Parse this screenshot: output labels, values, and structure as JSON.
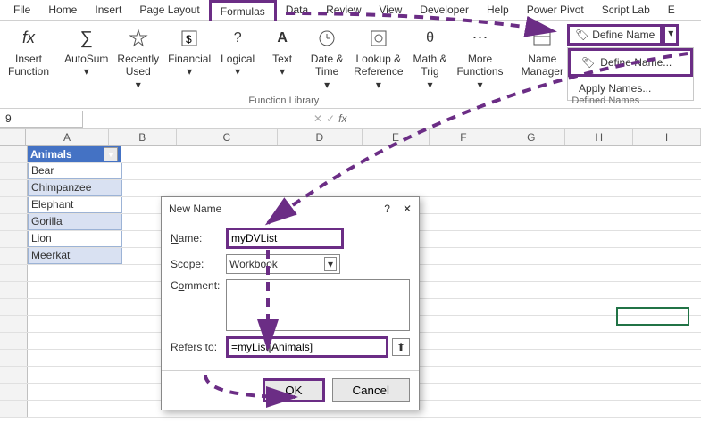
{
  "tabs": {
    "file": "File",
    "home": "Home",
    "insert": "Insert",
    "page_layout": "Page Layout",
    "formulas": "Formulas",
    "data": "Data",
    "review": "Review",
    "view": "View",
    "developer": "Developer",
    "help": "Help",
    "power_pivot": "Power Pivot",
    "script_lab": "Script Lab",
    "extra": "E"
  },
  "ribbon": {
    "insert_function": "Insert\nFunction",
    "autosum": "AutoSum",
    "recently_used": "Recently\nUsed",
    "financial": "Financial",
    "logical": "Logical",
    "text": "Text",
    "date_time": "Date &\nTime",
    "lookup_ref": "Lookup &\nReference",
    "math_trig": "Math &\nTrig",
    "more_functions": "More\nFunctions",
    "name_manager": "Name\nManager",
    "define_name": "Define Name",
    "define_name_menu": "Define Name...",
    "apply_names": "Apply Names...",
    "group_function_library": "Function Library",
    "group_defined_names": "Defined Names"
  },
  "name_box": "9",
  "fx_bar": {
    "check": "✓",
    "x": "✕",
    "fx": "fx"
  },
  "columns": [
    "A",
    "B",
    "C",
    "D",
    "E",
    "F",
    "G",
    "H",
    "I"
  ],
  "table": {
    "header": "Animals",
    "rows": [
      "Bear",
      "Chimpanzee",
      "Elephant",
      "Gorilla",
      "Lion",
      "Meerkat"
    ]
  },
  "dialog": {
    "title": "New Name",
    "help": "?",
    "close": "✕",
    "labels": {
      "name": "Name:",
      "scope": "Scope:",
      "comment": "Comment:",
      "refers_to": "Refers to:"
    },
    "values": {
      "name": "myDVList",
      "scope": "Workbook",
      "comment": "",
      "refers_to": "=myList[Animals]"
    },
    "buttons": {
      "ok": "OK",
      "cancel": "Cancel"
    },
    "collapse": "⬆"
  }
}
